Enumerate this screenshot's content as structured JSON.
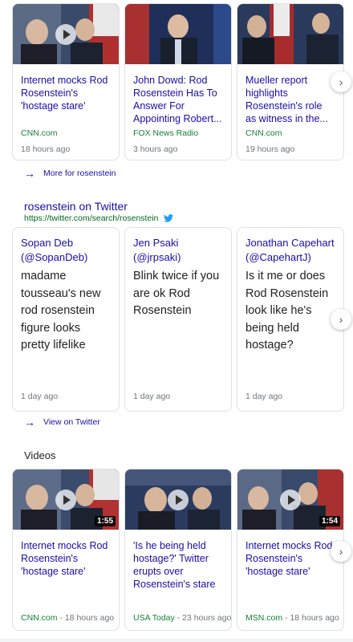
{
  "colors": {
    "link": "#1a0dab",
    "source": "#188038",
    "meta": "#70757a",
    "twitter": "#1da1f2"
  },
  "top_news": {
    "cards": [
      {
        "title": "Internet mocks Rod Rosenstein's 'hostage stare'",
        "source": "CNN.com",
        "ago": "18 hours ago",
        "has_play": true
      },
      {
        "title": "John Dowd: Rod Rosenstein Has To Answer For Appointing Robert...",
        "source": "FOX News Radio",
        "ago": "3 hours ago",
        "has_play": false
      },
      {
        "title": "Mueller report highlights Rosenstein's role as witness in the...",
        "source": "CNN.com",
        "ago": "19 hours ago",
        "has_play": false
      }
    ],
    "more_label": "More for rosenstein"
  },
  "twitter": {
    "title": "rosenstein on Twitter",
    "url": "https://twitter.com/search/rosenstein",
    "tweets": [
      {
        "name": "Sopan Deb (@SopanDeb)",
        "text": "madame tousseau's new rod rosenstein figure looks pretty lifelike",
        "time": "1 day ago"
      },
      {
        "name": "Jen Psaki (@jrpsaki)",
        "text": "Blink twice if you are ok Rod Rosenstein",
        "time": "1 day ago"
      },
      {
        "name": "Jonathan Capehart (@CapehartJ)",
        "text": "Is it me or does Rod Rosenstein look like he's being held hostage?",
        "time": "1 day ago"
      }
    ],
    "view_label": "View on Twitter"
  },
  "videos": {
    "heading": "Videos",
    "items": [
      {
        "title": "Internet mocks Rod Rosenstein's 'hostage stare'",
        "duration": "1:55",
        "source": "CNN.com",
        "meta": " - 18 hours ago"
      },
      {
        "title": "'Is he being held hostage?' Twitter erupts over Rosenstein's stare from ...",
        "duration": "",
        "source": "USA Today",
        "meta": " - 23 hours ago"
      },
      {
        "title": "Internet mocks Rod Rosenstein's 'hostage stare'",
        "duration": "1:54",
        "source": "MSN.com",
        "meta": " - 18 hours ago"
      }
    ]
  }
}
